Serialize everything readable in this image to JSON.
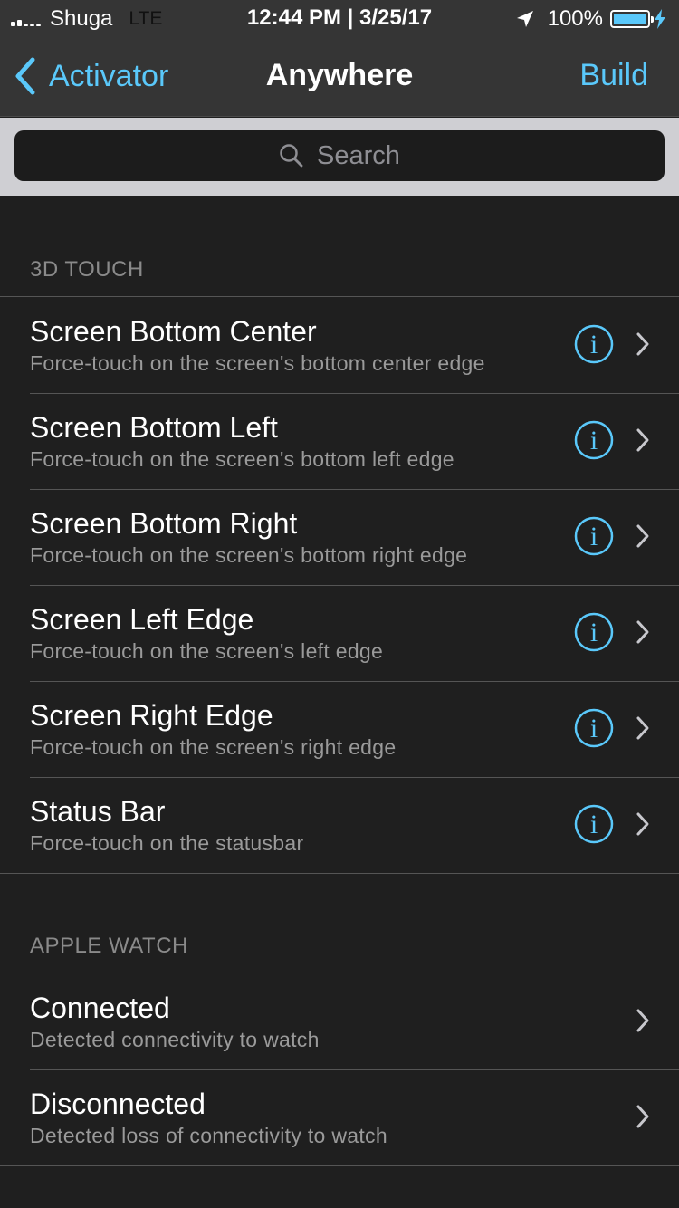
{
  "status_bar": {
    "carrier": "Shuga",
    "network": "LTE",
    "time_date": "12:44 PM | 3/25/17",
    "battery_percent": "100%"
  },
  "nav": {
    "back_label": "Activator",
    "title": "Anywhere",
    "right_label": "Build"
  },
  "search": {
    "placeholder": "Search"
  },
  "colors": {
    "accent": "#5ac8fa",
    "background": "#1f1f1f",
    "navbar": "#353535"
  },
  "sections": [
    {
      "header": "3D TOUCH",
      "rows": [
        {
          "title": "Screen Bottom Center",
          "subtitle": "Force-touch on the screen's bottom center edge",
          "has_info": true
        },
        {
          "title": "Screen Bottom Left",
          "subtitle": "Force-touch on the screen's bottom left edge",
          "has_info": true
        },
        {
          "title": "Screen Bottom Right",
          "subtitle": "Force-touch on the screen's bottom right edge",
          "has_info": true
        },
        {
          "title": "Screen Left Edge",
          "subtitle": "Force-touch on the screen's left edge",
          "has_info": true
        },
        {
          "title": "Screen Right Edge",
          "subtitle": "Force-touch on the screen's right edge",
          "has_info": true
        },
        {
          "title": "Status Bar",
          "subtitle": "Force-touch on the statusbar",
          "has_info": true
        }
      ]
    },
    {
      "header": "APPLE WATCH",
      "rows": [
        {
          "title": "Connected",
          "subtitle": "Detected connectivity to watch",
          "has_info": false
        },
        {
          "title": "Disconnected",
          "subtitle": "Detected loss of connectivity to watch",
          "has_info": false
        }
      ]
    }
  ]
}
